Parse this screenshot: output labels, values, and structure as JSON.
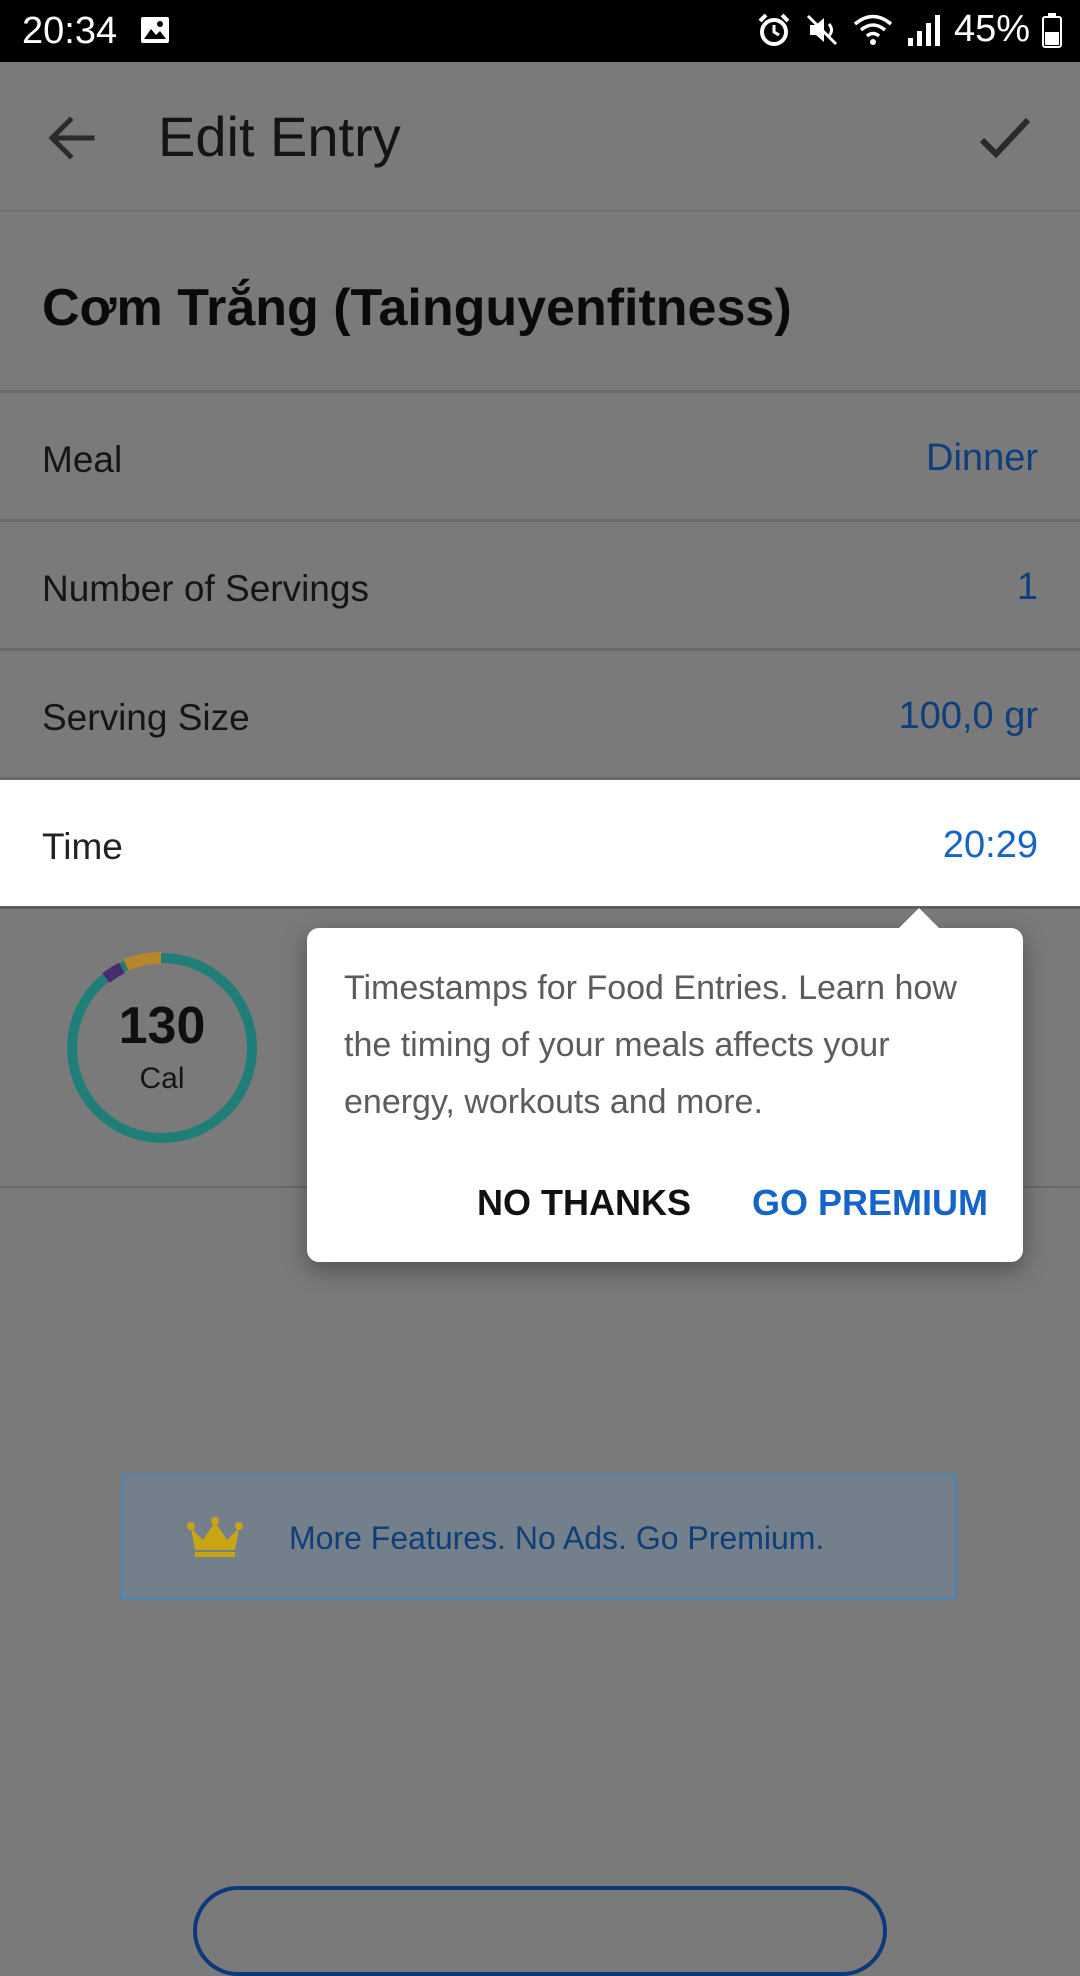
{
  "status_bar": {
    "time": "20:34",
    "battery": "45%",
    "icons": [
      "image-icon",
      "alarm-icon",
      "mute-icon",
      "wifi-icon",
      "signal-icon",
      "battery-icon"
    ]
  },
  "app_bar": {
    "title": "Edit Entry",
    "back_icon": "arrow-left-icon",
    "confirm_icon": "check-icon"
  },
  "food": {
    "name": "Cơm Trắng (Tainguyenfitness)"
  },
  "fields": [
    {
      "label": "Meal",
      "value": "Dinner"
    },
    {
      "label": "Number of Servings",
      "value": "1"
    },
    {
      "label": "Serving Size",
      "value": "100,0 gr"
    },
    {
      "label": "Time",
      "value": "20:29"
    }
  ],
  "calories": {
    "value": "130",
    "unit": "Cal"
  },
  "tooltip": {
    "message": "Timestamps for Food Entries. Learn how the timing of your meals affects your energy, workouts and more.",
    "no_thanks_label": "NO THANKS",
    "go_premium_label": "GO PREMIUM"
  },
  "premium_banner": {
    "text": "More Features. No Ads. Go Premium.",
    "icon": "crown-icon"
  },
  "colors": {
    "accent": "#1565c8",
    "ring_teal": "#1f7f78",
    "ring_orange": "#b8862a",
    "ring_purple": "#4a2b6e",
    "crown": "#c9a516"
  }
}
